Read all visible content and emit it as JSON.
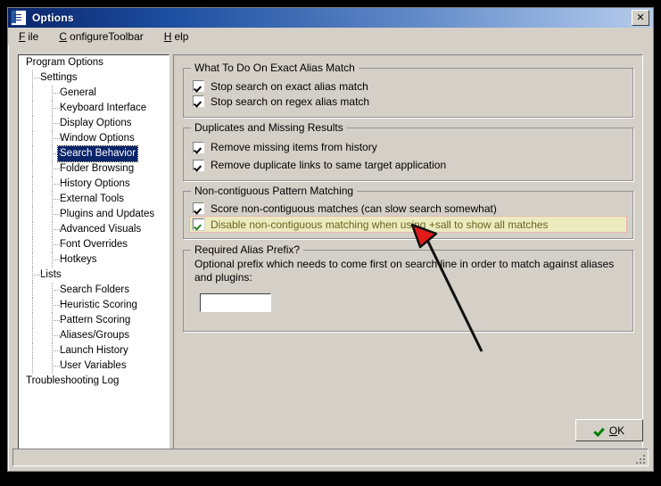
{
  "window": {
    "title": "Options",
    "icon": "options-checklist-icon",
    "close_label": "✕"
  },
  "menubar": {
    "items": [
      {
        "label": "File",
        "accel": "F"
      },
      {
        "label": "ConfigureToolbar",
        "accel": "C"
      },
      {
        "label": "Help",
        "accel": "H"
      }
    ]
  },
  "tree": {
    "selected": "Search Behavior",
    "items": [
      {
        "label": "Program Options",
        "level": 0
      },
      {
        "label": "Settings",
        "level": 1
      },
      {
        "label": "General",
        "level": 2
      },
      {
        "label": "Keyboard Interface",
        "level": 2
      },
      {
        "label": "Display Options",
        "level": 2
      },
      {
        "label": "Window Options",
        "level": 2
      },
      {
        "label": "Search Behavior",
        "level": 2
      },
      {
        "label": "Folder Browsing",
        "level": 2
      },
      {
        "label": "History Options",
        "level": 2
      },
      {
        "label": "External Tools",
        "level": 2
      },
      {
        "label": "Plugins and Updates",
        "level": 2
      },
      {
        "label": "Advanced Visuals",
        "level": 2
      },
      {
        "label": "Font Overrides",
        "level": 2
      },
      {
        "label": "Hotkeys",
        "level": 2
      },
      {
        "label": "Lists",
        "level": 1
      },
      {
        "label": "Search Folders",
        "level": 2
      },
      {
        "label": "Heuristic Scoring",
        "level": 2
      },
      {
        "label": "Pattern Scoring",
        "level": 2
      },
      {
        "label": "Aliases/Groups",
        "level": 2
      },
      {
        "label": "Launch History",
        "level": 2
      },
      {
        "label": "User Variables",
        "level": 2
      },
      {
        "label": "Troubleshooting Log",
        "level": 0
      }
    ]
  },
  "groups": {
    "exact_match": {
      "title": "What To Do On Exact Alias Match",
      "options": [
        {
          "label": "Stop search on exact alias match",
          "checked": true
        },
        {
          "label": "Stop search on regex alias match",
          "checked": true
        }
      ]
    },
    "duplicates": {
      "title": "Duplicates and Missing Results",
      "options": [
        {
          "label": "Remove missing items from history",
          "checked": true
        },
        {
          "label": "Remove duplicate links to same target application",
          "checked": true
        }
      ]
    },
    "noncontiguous": {
      "title": "Non-contiguous Pattern Matching",
      "options": [
        {
          "label": "Score non-contiguous matches (can slow search somewhat)",
          "checked": true,
          "highlighted": false
        },
        {
          "label": "Disable non-contiguous matching when using +sall to show all matches",
          "checked": true,
          "highlighted": true
        }
      ]
    },
    "alias_prefix": {
      "title": "Required Alias Prefix?",
      "description": "Optional prefix which needs to come first on search line in order to match against aliases and plugins:",
      "input_value": "",
      "input_placeholder": ""
    }
  },
  "buttons": {
    "ok": {
      "label": "OK",
      "accel": "O",
      "icon": "green-check-icon"
    }
  },
  "statusbar": {
    "text": ""
  },
  "colors": {
    "face": "#d4d0c8",
    "title_left": "#0a246a",
    "title_right": "#b6cbe8",
    "selection": "#0a246a",
    "highlight_fill": "#ecebbe",
    "highlight_border": "#e8b4b8",
    "highlight_text": "#6b6420",
    "annotation_red": "#e01b1b",
    "ok_check_green": "#008000"
  },
  "annotation": {
    "type": "arrow",
    "points_to": "Disable non-contiguous matching when using +sall to show all matches"
  }
}
